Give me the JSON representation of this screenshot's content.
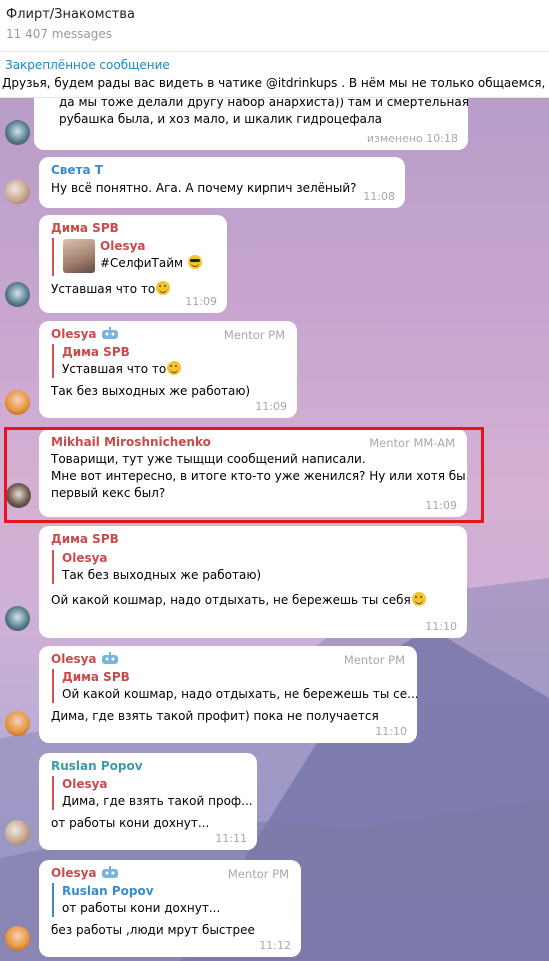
{
  "header": {
    "title": "Флирт/Знакомства",
    "count": "11 407 messages"
  },
  "pinned": {
    "title": "Закреплённое сообщение",
    "text": "Друзья, будем рады вас видеть в чатике @itdrinkups . В нём мы не только общаемся, но"
  },
  "messages": [
    {
      "lines": [
        "да мы тоже делали другу набор анархиста)) там и смертельная",
        "рубашка была, и хоз мало, и шкалик гидроцефала"
      ],
      "time": "изменено 10:18"
    },
    {
      "sender": "Света Т",
      "lines": [
        "Ну всё понятно. Ага. А почему кирпич зелёный?"
      ],
      "time": "11:08"
    },
    {
      "sender": "Дима SPB",
      "reply_name": "Olesya",
      "reply_text": "#СелфиТайм",
      "lines": [
        "Уставшая что то"
      ],
      "time": "11:09"
    },
    {
      "sender": "Olesya",
      "tag": "Mentor PM",
      "reply_name": "Дима SPB",
      "reply_text": "Уставшая что то",
      "lines": [
        "Так без выходных же работаю)"
      ],
      "time": "11:09"
    },
    {
      "sender": "Mikhail Miroshnichenko",
      "tag": "Mentor MM-AM",
      "lines": [
        "Товарищи, тут уже тыщщи сообщений написали.",
        "Мне вот интересно, в итоге кто-то уже женился? Ну или хотя бы",
        "первый кекс был?"
      ],
      "time": "11:09"
    },
    {
      "sender": "Дима SPB",
      "reply_name": "Olesya",
      "reply_text": "Так без выходных же работаю)",
      "lines": [
        "Ой какой кошмар, надо отдыхать, не бережешь ты себя"
      ],
      "time": "11:10"
    },
    {
      "sender": "Olesya",
      "tag": "Mentor PM",
      "reply_name": "Дима SPB",
      "reply_text": "Ой какой кошмар, надо отдыхать, не бережешь ты се...",
      "lines": [
        "Дима, где взять такой профит) пока не получается"
      ],
      "time": "11:10"
    },
    {
      "sender": "Ruslan Popov",
      "reply_name": "Olesya",
      "reply_text": "Дима, где взять такой проф...",
      "lines": [
        "от работы кони дохнут..."
      ],
      "time": "11:11"
    },
    {
      "sender": "Olesya",
      "tag": "Mentor PM",
      "reply_name": "Ruslan Popov",
      "reply_text": "от работы кони дохнут...",
      "lines": [
        "без работы ,люди мрут быстрее"
      ],
      "time": "11:12"
    }
  ],
  "colors": {
    "accent": "#168acd",
    "sender_red": "#c94b4b",
    "sender_blue": "#3a8dc7",
    "sender_teal": "#3d9aa6",
    "highlight": "#e8141c"
  },
  "icons": [
    "bot-icon",
    "wink-emoji",
    "cool-emoji"
  ]
}
